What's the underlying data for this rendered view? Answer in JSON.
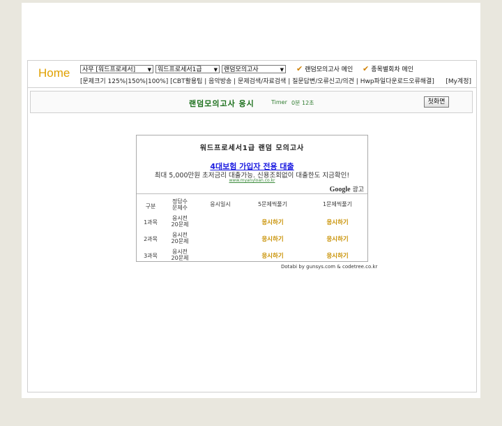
{
  "header": {
    "home_label": "Home",
    "selects": [
      {
        "value": "사무 [워드프로세서]"
      },
      {
        "value": "워드프로세서1급"
      },
      {
        "value": "랜덤모의고사"
      }
    ],
    "check_links": [
      "랜덤모의고사 메인",
      "종목별회차 메인"
    ],
    "nav_links": "[문제크기 125%|150%|100%] [CBT활용팁 | 음악방송 | 문제검색/자료검색 | 질문답변/오류신고/의견 | Hwp파일다운로드오류해결]",
    "account_link": "[My계정]"
  },
  "exam_bar": {
    "title": "랜덤모의고사 응시",
    "timer_label": "Timer",
    "timer_value": "0분 12초",
    "first_button": "첫화면"
  },
  "exam_box": {
    "title": "워드프로세서1급 랜덤 모의고사",
    "ad": {
      "title": "4대보험 가입자 전용 대출",
      "text": "최대 5,000만원 초저금리 대출가능. 신용조회없이 대출한도 지금확인!",
      "url": "www.myanyloan.co.kr",
      "google_label": "Google",
      "ad_label": "광고"
    },
    "columns": [
      "구분",
      "정답수",
      "문제수",
      "응시일시",
      "5문제씩풀기",
      "1문제씩풀기"
    ],
    "rows": [
      {
        "subject": "1과목",
        "status": "응시전",
        "count": "20문제",
        "date": "",
        "five": "응시하기",
        "one": "응시하기"
      },
      {
        "subject": "2과목",
        "status": "응시전",
        "count": "20문제",
        "date": "",
        "five": "응시하기",
        "one": "응시하기"
      },
      {
        "subject": "3과목",
        "status": "응시전",
        "count": "20문제",
        "date": "",
        "five": "응시하기",
        "one": "응시하기"
      }
    ]
  },
  "credit": "Dotabi by gunsys.com & codetree.co.kr"
}
